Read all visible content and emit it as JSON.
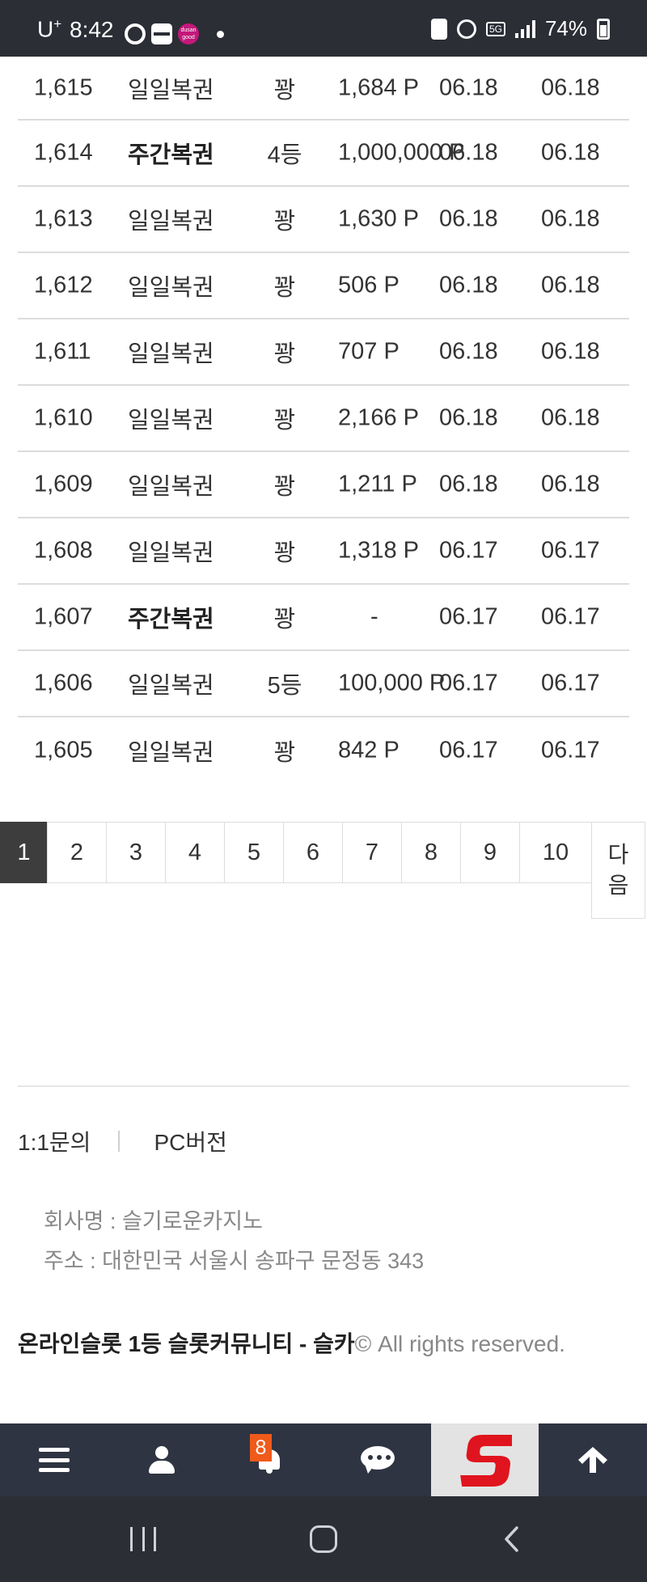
{
  "status_bar": {
    "carrier": "U",
    "carrier_sup": "+",
    "time": "8:42",
    "app_icon_3_text": "dusan good",
    "network": "5G",
    "battery": "74%"
  },
  "table": {
    "rows": [
      {
        "no": "1,615",
        "type": "일일복권",
        "rank": "꽝",
        "point": "1,684 P",
        "date1": "06.18",
        "date2": "06.18"
      },
      {
        "no": "1,614",
        "type": "주간복권",
        "rank": "4등",
        "point": "1,000,000 P",
        "date1": "06.18",
        "date2": "06.18"
      },
      {
        "no": "1,613",
        "type": "일일복권",
        "rank": "꽝",
        "point": "1,630 P",
        "date1": "06.18",
        "date2": "06.18"
      },
      {
        "no": "1,612",
        "type": "일일복권",
        "rank": "꽝",
        "point": "506 P",
        "date1": "06.18",
        "date2": "06.18"
      },
      {
        "no": "1,611",
        "type": "일일복권",
        "rank": "꽝",
        "point": "707 P",
        "date1": "06.18",
        "date2": "06.18"
      },
      {
        "no": "1,610",
        "type": "일일복권",
        "rank": "꽝",
        "point": "2,166 P",
        "date1": "06.18",
        "date2": "06.18"
      },
      {
        "no": "1,609",
        "type": "일일복권",
        "rank": "꽝",
        "point": "1,211 P",
        "date1": "06.18",
        "date2": "06.18"
      },
      {
        "no": "1,608",
        "type": "일일복권",
        "rank": "꽝",
        "point": "1,318 P",
        "date1": "06.17",
        "date2": "06.17"
      },
      {
        "no": "1,607",
        "type": "주간복권",
        "rank": "꽝",
        "point": "-",
        "date1": "06.17",
        "date2": "06.17"
      },
      {
        "no": "1,606",
        "type": "일일복권",
        "rank": "5등",
        "point": "100,000 P",
        "date1": "06.17",
        "date2": "06.17"
      },
      {
        "no": "1,605",
        "type": "일일복권",
        "rank": "꽝",
        "point": "842 P",
        "date1": "06.17",
        "date2": "06.17"
      }
    ]
  },
  "pagination": {
    "pages": [
      "1",
      "2",
      "3",
      "4",
      "5",
      "6",
      "7",
      "8",
      "9",
      "10"
    ],
    "current": "1",
    "next_line1": "다",
    "next_line2": "음"
  },
  "footer": {
    "inquiry": "1:1문의",
    "pc_version": "PC버전",
    "company": "회사명 : 슬기로운카지노",
    "address": "주소 : 대한민국 서울시 송파구 문정동 343",
    "brand": "온라인슬롯 1등 슬롯커뮤니티 - 슬카",
    "rights": "© All rights reserved."
  },
  "bottom_bar": {
    "notification_count": "8",
    "icons": [
      "menu-icon",
      "user-icon",
      "bell-icon",
      "chat-icon",
      "site-logo",
      "arrow-up-icon"
    ]
  },
  "colors": {
    "dark_bar": "#2b2e35",
    "app_bar": "#2e3441",
    "active_page": "#3d3d3d",
    "badge": "#f05a1a",
    "logo_red": "#e0141e"
  }
}
